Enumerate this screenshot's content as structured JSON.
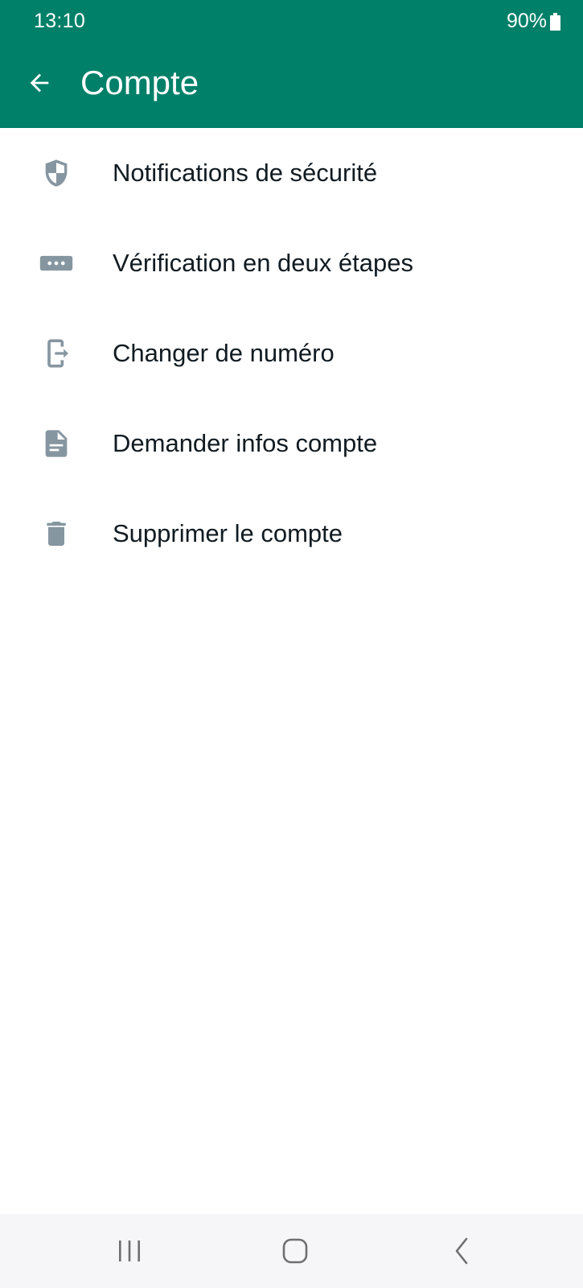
{
  "status_bar": {
    "time": "13:10",
    "battery_percent": "90%"
  },
  "header": {
    "title": "Compte",
    "back_icon": "arrow-left-icon"
  },
  "menu": {
    "items": [
      {
        "label": "Notifications de sécurité",
        "icon": "shield-icon"
      },
      {
        "label": "Vérification en deux étapes",
        "icon": "password-dots-icon"
      },
      {
        "label": "Changer de numéro",
        "icon": "phone-transfer-icon"
      },
      {
        "label": "Demander infos compte",
        "icon": "document-icon"
      },
      {
        "label": "Supprimer le compte",
        "icon": "trash-icon"
      }
    ]
  },
  "navigation": {
    "recents_icon": "recents-icon",
    "home_icon": "home-icon",
    "back_icon": "chevron-left-icon"
  },
  "colors": {
    "primary": "#008069",
    "icon_gray": "#8696a0",
    "text": "#111b21",
    "nav_bg": "#f6f6f8"
  }
}
